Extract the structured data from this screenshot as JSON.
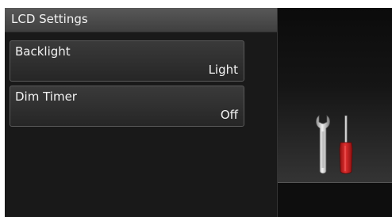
{
  "header": {
    "title": "LCD Settings"
  },
  "menu": {
    "items": [
      {
        "label": "Backlight",
        "value": "Light"
      },
      {
        "label": "Dim Timer",
        "value": "Off"
      }
    ]
  },
  "side_panel": {
    "icon": "tools-icon",
    "colors": {
      "screwdriver_handle": "#cc1e1e",
      "wrench": "#c8c8c8"
    }
  }
}
